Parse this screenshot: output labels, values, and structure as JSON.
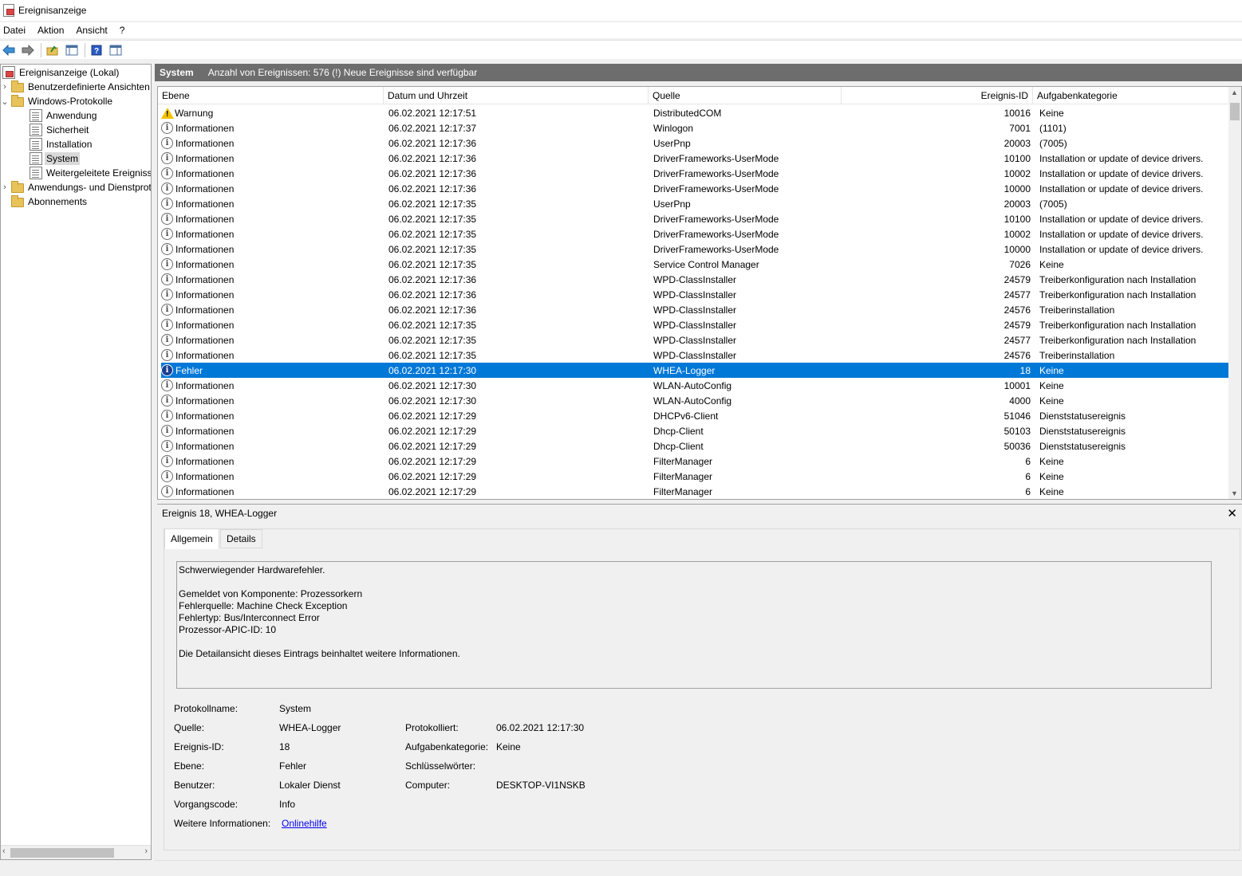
{
  "window": {
    "title": "Ereignisanzeige"
  },
  "menu": [
    "Datei",
    "Aktion",
    "Ansicht",
    "?"
  ],
  "toolbar": {
    "buttons": [
      "back-arrow-icon",
      "forward-arrow-icon",
      "up-folder-icon",
      "show-hide-tree-icon",
      "help-icon",
      "properties-icon"
    ]
  },
  "tree": {
    "items": [
      {
        "label": "Ereignisanzeige (Lokal)",
        "icon": "event-viewer-icon",
        "level": 0,
        "expander": ""
      },
      {
        "label": "Benutzerdefinierte Ansichten",
        "icon": "folder-icon",
        "level": 1,
        "expander": "›"
      },
      {
        "label": "Windows-Protokolle",
        "icon": "folder-icon",
        "level": 1,
        "expander": "⌄"
      },
      {
        "label": "Anwendung",
        "icon": "log-icon",
        "level": 2,
        "expander": ""
      },
      {
        "label": "Sicherheit",
        "icon": "log-icon",
        "level": 2,
        "expander": ""
      },
      {
        "label": "Installation",
        "icon": "log-icon",
        "level": 2,
        "expander": ""
      },
      {
        "label": "System",
        "icon": "log-icon",
        "level": 2,
        "expander": "",
        "selected": true
      },
      {
        "label": "Weitergeleitete Ereignisse",
        "icon": "log-icon",
        "level": 2,
        "expander": ""
      },
      {
        "label": "Anwendungs- und Dienstprotokolle",
        "icon": "folder-icon",
        "level": 1,
        "expander": "›"
      },
      {
        "label": "Abonnements",
        "icon": "folder-icon",
        "level": 1,
        "expander": ""
      }
    ]
  },
  "list_header": {
    "title": "System",
    "info": "Anzahl von Ereignissen: 576 (!) Neue Ereignisse sind verfügbar"
  },
  "columns": [
    "Ebene",
    "Datum und Uhrzeit",
    "Quelle",
    "Ereignis-ID",
    "Aufgabenkategorie"
  ],
  "events": [
    {
      "level": "Warnung",
      "icon": "warning-icon",
      "date": "06.02.2021 12:17:51",
      "source": "DistributedCOM",
      "id": "10016",
      "task": "Keine"
    },
    {
      "level": "Informationen",
      "icon": "info-icon",
      "date": "06.02.2021 12:17:37",
      "source": "Winlogon",
      "id": "7001",
      "task": "(1101)"
    },
    {
      "level": "Informationen",
      "icon": "info-icon",
      "date": "06.02.2021 12:17:36",
      "source": "UserPnp",
      "id": "20003",
      "task": "(7005)"
    },
    {
      "level": "Informationen",
      "icon": "info-icon",
      "date": "06.02.2021 12:17:36",
      "source": "DriverFrameworks-UserMode",
      "id": "10100",
      "task": "Installation or update of device drivers."
    },
    {
      "level": "Informationen",
      "icon": "info-icon",
      "date": "06.02.2021 12:17:36",
      "source": "DriverFrameworks-UserMode",
      "id": "10002",
      "task": "Installation or update of device drivers."
    },
    {
      "level": "Informationen",
      "icon": "info-icon",
      "date": "06.02.2021 12:17:36",
      "source": "DriverFrameworks-UserMode",
      "id": "10000",
      "task": "Installation or update of device drivers."
    },
    {
      "level": "Informationen",
      "icon": "info-icon",
      "date": "06.02.2021 12:17:35",
      "source": "UserPnp",
      "id": "20003",
      "task": "(7005)"
    },
    {
      "level": "Informationen",
      "icon": "info-icon",
      "date": "06.02.2021 12:17:35",
      "source": "DriverFrameworks-UserMode",
      "id": "10100",
      "task": "Installation or update of device drivers."
    },
    {
      "level": "Informationen",
      "icon": "info-icon",
      "date": "06.02.2021 12:17:35",
      "source": "DriverFrameworks-UserMode",
      "id": "10002",
      "task": "Installation or update of device drivers."
    },
    {
      "level": "Informationen",
      "icon": "info-icon",
      "date": "06.02.2021 12:17:35",
      "source": "DriverFrameworks-UserMode",
      "id": "10000",
      "task": "Installation or update of device drivers."
    },
    {
      "level": "Informationen",
      "icon": "info-icon",
      "date": "06.02.2021 12:17:35",
      "source": "Service Control Manager",
      "id": "7026",
      "task": "Keine"
    },
    {
      "level": "Informationen",
      "icon": "info-icon",
      "date": "06.02.2021 12:17:36",
      "source": "WPD-ClassInstaller",
      "id": "24579",
      "task": "Treiberkonfiguration nach Installation"
    },
    {
      "level": "Informationen",
      "icon": "info-icon",
      "date": "06.02.2021 12:17:36",
      "source": "WPD-ClassInstaller",
      "id": "24577",
      "task": "Treiberkonfiguration nach Installation"
    },
    {
      "level": "Informationen",
      "icon": "info-icon",
      "date": "06.02.2021 12:17:36",
      "source": "WPD-ClassInstaller",
      "id": "24576",
      "task": "Treiberinstallation"
    },
    {
      "level": "Informationen",
      "icon": "info-icon",
      "date": "06.02.2021 12:17:35",
      "source": "WPD-ClassInstaller",
      "id": "24579",
      "task": "Treiberkonfiguration nach Installation"
    },
    {
      "level": "Informationen",
      "icon": "info-icon",
      "date": "06.02.2021 12:17:35",
      "source": "WPD-ClassInstaller",
      "id": "24577",
      "task": "Treiberkonfiguration nach Installation"
    },
    {
      "level": "Informationen",
      "icon": "info-icon",
      "date": "06.02.2021 12:17:35",
      "source": "WPD-ClassInstaller",
      "id": "24576",
      "task": "Treiberinstallation"
    },
    {
      "level": "Fehler",
      "icon": "info-icon",
      "date": "06.02.2021 12:17:30",
      "source": "WHEA-Logger",
      "id": "18",
      "task": "Keine",
      "selected": true
    },
    {
      "level": "Informationen",
      "icon": "info-icon",
      "date": "06.02.2021 12:17:30",
      "source": "WLAN-AutoConfig",
      "id": "10001",
      "task": "Keine"
    },
    {
      "level": "Informationen",
      "icon": "info-icon",
      "date": "06.02.2021 12:17:30",
      "source": "WLAN-AutoConfig",
      "id": "4000",
      "task": "Keine"
    },
    {
      "level": "Informationen",
      "icon": "info-icon",
      "date": "06.02.2021 12:17:29",
      "source": "DHCPv6-Client",
      "id": "51046",
      "task": "Dienststatusereignis"
    },
    {
      "level": "Informationen",
      "icon": "info-icon",
      "date": "06.02.2021 12:17:29",
      "source": "Dhcp-Client",
      "id": "50103",
      "task": "Dienststatusereignis"
    },
    {
      "level": "Informationen",
      "icon": "info-icon",
      "date": "06.02.2021 12:17:29",
      "source": "Dhcp-Client",
      "id": "50036",
      "task": "Dienststatusereignis"
    },
    {
      "level": "Informationen",
      "icon": "info-icon",
      "date": "06.02.2021 12:17:29",
      "source": "FilterManager",
      "id": "6",
      "task": "Keine"
    },
    {
      "level": "Informationen",
      "icon": "info-icon",
      "date": "06.02.2021 12:17:29",
      "source": "FilterManager",
      "id": "6",
      "task": "Keine"
    },
    {
      "level": "Informationen",
      "icon": "info-icon",
      "date": "06.02.2021 12:17:29",
      "source": "FilterManager",
      "id": "6",
      "task": "Keine"
    }
  ],
  "detail": {
    "title": "Ereignis 18, WHEA-Logger",
    "close": "✕",
    "tabs": [
      "Allgemein",
      "Details"
    ],
    "active_tab": "Allgemein",
    "message_lines": [
      "Schwerwiegender Hardwarefehler.",
      "",
      "Gemeldet von Komponente: Prozessorkern",
      "Fehlerquelle: Machine Check Exception",
      "Fehlertyp: Bus/Interconnect Error",
      "Prozessor-APIC-ID: 10",
      "",
      "Die Detailansicht dieses Eintrags beinhaltet weitere Informationen."
    ],
    "properties": {
      "protokollname_label": "Protokollname:",
      "protokollname": "System",
      "quelle_label": "Quelle:",
      "quelle": "WHEA-Logger",
      "protokolliert_label": "Protokolliert:",
      "protokolliert": "06.02.2021 12:17:30",
      "ereignis_id_label": "Ereignis-ID:",
      "ereignis_id": "18",
      "aufgabenkategorie_label": "Aufgabenkategorie:",
      "aufgabenkategorie": "Keine",
      "ebene_label": "Ebene:",
      "ebene": "Fehler",
      "schluesselwoerter_label": "Schlüsselwörter:",
      "schluesselwoerter": "",
      "benutzer_label": "Benutzer:",
      "benutzer": "Lokaler Dienst",
      "computer_label": "Computer:",
      "computer": "DESKTOP-VI1NSKB",
      "vorgangscode_label": "Vorgangscode:",
      "vorgangscode": "Info",
      "weitere_label": "Weitere Informationen:",
      "weitere_link": "Onlinehilfe"
    }
  },
  "colors": {
    "selection": "#0078d7",
    "header_bar": "#6d6d6d",
    "link": "#0000ee"
  }
}
